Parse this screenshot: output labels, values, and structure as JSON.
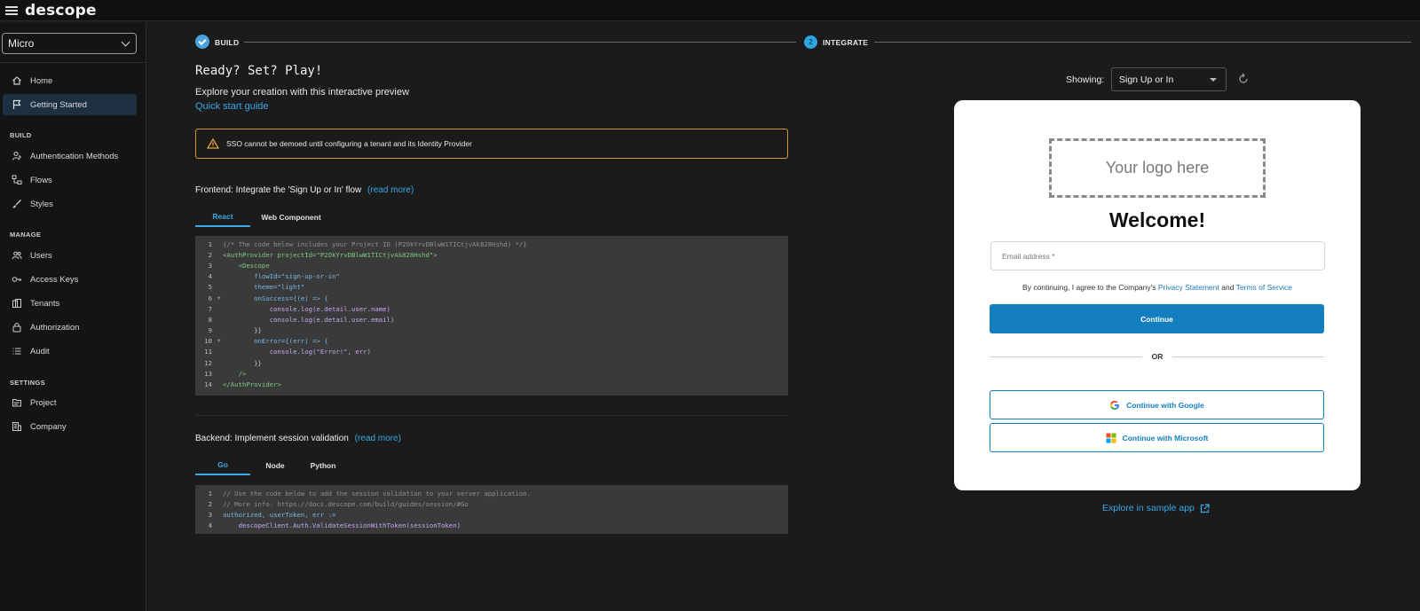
{
  "app": {
    "logo_text": "descope"
  },
  "sidebar": {
    "project": "Micro",
    "items": {
      "home": "Home",
      "getting_started": "Getting Started",
      "auth_methods": "Authentication Methods",
      "flows": "Flows",
      "styles": "Styles",
      "users": "Users",
      "access_keys": "Access Keys",
      "tenants": "Tenants",
      "authorization": "Authorization",
      "audit": "Audit",
      "project": "Project",
      "company": "Company"
    },
    "sections": {
      "build": "BUILD",
      "manage": "MANAGE",
      "settings": "SETTINGS"
    }
  },
  "stepper": {
    "step1": "BUILD",
    "step2_num": "2",
    "step2": "INTEGRATE"
  },
  "main": {
    "title": "Ready? Set? Play!",
    "subtitle": "Explore your creation with this interactive preview",
    "quick_start": "Quick start guide",
    "warning": "SSO cannot be demoed until configuring a tenant and its Identity Provider",
    "frontend": {
      "heading": "Frontend: Integrate the 'Sign Up or In' flow",
      "read_more": "(read more)",
      "tabs": [
        "React",
        "Web Component"
      ],
      "line_numbers": [
        "1",
        "2",
        "3",
        "4",
        "5",
        "6",
        "7",
        "8",
        "9",
        "10",
        "11",
        "12",
        "13",
        "14"
      ],
      "lines": [
        "{/* The code below includes your Project ID (P2OkYrvDBlwW1TICtjvAk828Hshd) */}",
        "<AuthProvider projectId=\"P2OkYrvDBlwW1TICtjvAk828Hshd\">",
        "    <Descope",
        "        flowId=\"sign-up-or-in\"",
        "        theme=\"light\"",
        "        onSuccess={(e) => {",
        "            console.log(e.detail.user.name)",
        "            console.log(e.detail.user.email)",
        "        }}",
        "        onError={(err) => {",
        "            console.log(\"Error!\", err)",
        "        }}",
        "    />",
        "</AuthProvider>"
      ]
    },
    "backend": {
      "heading": "Backend: Implement session validation",
      "read_more": "(read more)",
      "tabs": [
        "Go",
        "Node",
        "Python"
      ],
      "line_numbers": [
        "1",
        "2",
        "3",
        "4"
      ],
      "lines": [
        "// Use the code below to add the session validation to your server application.",
        "// More info: https://docs.descope.com/build/guides/session/#Go",
        "authorized, userToken, err :=",
        "    descopeClient.Auth.ValidateSessionWithToken(sessionToken)"
      ]
    }
  },
  "preview": {
    "showing_label": "Showing:",
    "showing_value": "Sign Up or In",
    "logo_placeholder": "Your logo here",
    "welcome": "Welcome!",
    "email_placeholder": "Email address *",
    "terms_prefix": "By continuing, I agree to the Company's",
    "privacy": "Privacy Statement",
    "and": "and",
    "tos": "Terms of Service",
    "continue": "Continue",
    "or": "OR",
    "google": "Continue with Google",
    "microsoft": "Continue with Microsoft",
    "explore": "Explore in sample app"
  },
  "colors": {
    "accent": "#37a9e8",
    "warning_border": "#d39a34",
    "button": "#137fbf"
  }
}
